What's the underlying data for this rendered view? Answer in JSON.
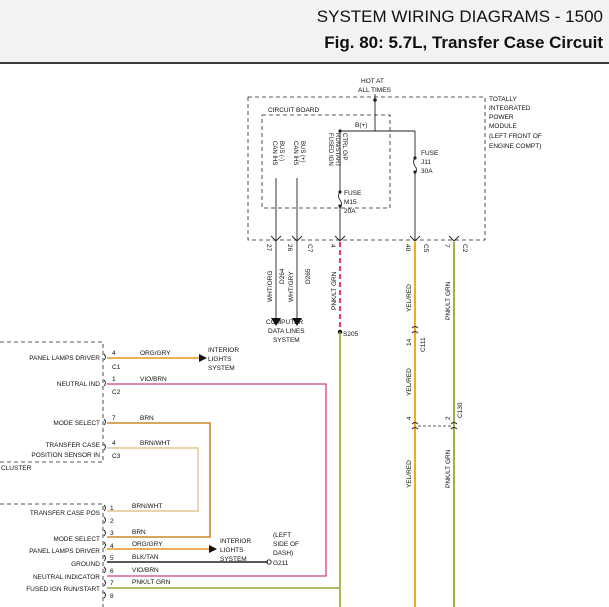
{
  "header": {
    "title": "SYSTEM WIRING DIAGRAMS - 1500",
    "subtitle": "Fig. 80: 5.7L, Transfer Case Circuit"
  },
  "tipm": {
    "label_lines": [
      "TOTALLY",
      "INTEGRATED",
      "POWER",
      "MODULE",
      "(LEFT FRONT OF",
      "ENGINE COMPT)"
    ],
    "hot_at": [
      "HOT AT",
      "ALL TIMES"
    ],
    "circuit_board": "CIRCUIT BOARD",
    "b_plus": "B(+)",
    "fuse_j11": [
      "FUSE",
      "J11",
      "30A"
    ],
    "fuse_m15": [
      "FUSE",
      "M15",
      "20A"
    ],
    "can_minus": [
      "CAN IHS",
      "BUS (-)"
    ],
    "can_plus": [
      "CAN IHS",
      "BUS (+)"
    ],
    "fused_ign": [
      "FUSED IGN",
      "RUN/START",
      "CTRL O/P"
    ],
    "pins": [
      "27",
      "26",
      "4",
      "40",
      "7"
    ],
    "connectors": [
      "C7",
      "C5",
      "C2"
    ]
  },
  "wires": {
    "d264": [
      "WHT/ORG",
      "D264"
    ],
    "d265": [
      "WHT/GRY",
      "D265"
    ],
    "pnk_lt_grn": "PNK/LT GRN",
    "yel_red": "YEL/RED",
    "computer_data_lines": [
      "COMPUTER",
      "DATA LINES",
      "SYSTEM"
    ],
    "splice": "S205",
    "c111": [
      "14",
      "C111"
    ],
    "c130": [
      "4",
      "2",
      "C130"
    ]
  },
  "cluster": {
    "label": "CLUSTER",
    "rows": [
      {
        "name": "PANEL LAMPS DRIVER",
        "pin": "4",
        "wire": "ORG/GRY",
        "conn": "C1"
      },
      {
        "name": "NEUTRAL IND",
        "pin": "1",
        "wire": "VIO/BRN",
        "conn": "C2"
      },
      {
        "name": "MODE SELECT",
        "pin": "7",
        "wire": "BRN"
      },
      {
        "name": "TRANSFER CASE",
        "name2": "POSITION SENSOR IN",
        "pin": "4",
        "wire": "BRN/WHT",
        "conn": "C3"
      }
    ],
    "interior_lights": [
      "INTERIOR",
      "LIGHTS",
      "SYSTEM"
    ]
  },
  "switch": {
    "rows": [
      {
        "name": "TRANSFER CASE POS",
        "pin": "1",
        "wire": "BRN/WHT"
      },
      {
        "name": "",
        "pin": "2",
        "wire": ""
      },
      {
        "name": "",
        "pin": "3",
        "wire": "BRN"
      },
      {
        "name": "MODE SELECT",
        "pin": "4",
        "wire": "ORG/GRY"
      },
      {
        "name": "PANEL LAMPS DRIVER",
        "pin": "5",
        "wire": "BLK/TAN"
      },
      {
        "name": "GROUND",
        "pin": "6",
        "wire": "VIO/BRN"
      },
      {
        "name": "NEUTRAL INDICATOR",
        "pin": "7",
        "wire": "PNK/LT GRN"
      },
      {
        "name": "FUSED IGN RUN/START",
        "pin": "8",
        "wire": ""
      }
    ],
    "interior_lights": [
      "INTERIOR",
      "LIGHTS",
      "SYSTEM"
    ],
    "ground_note": [
      "(LEFT",
      "SIDE OF",
      "DASH)"
    ],
    "ground_id": "G211"
  }
}
